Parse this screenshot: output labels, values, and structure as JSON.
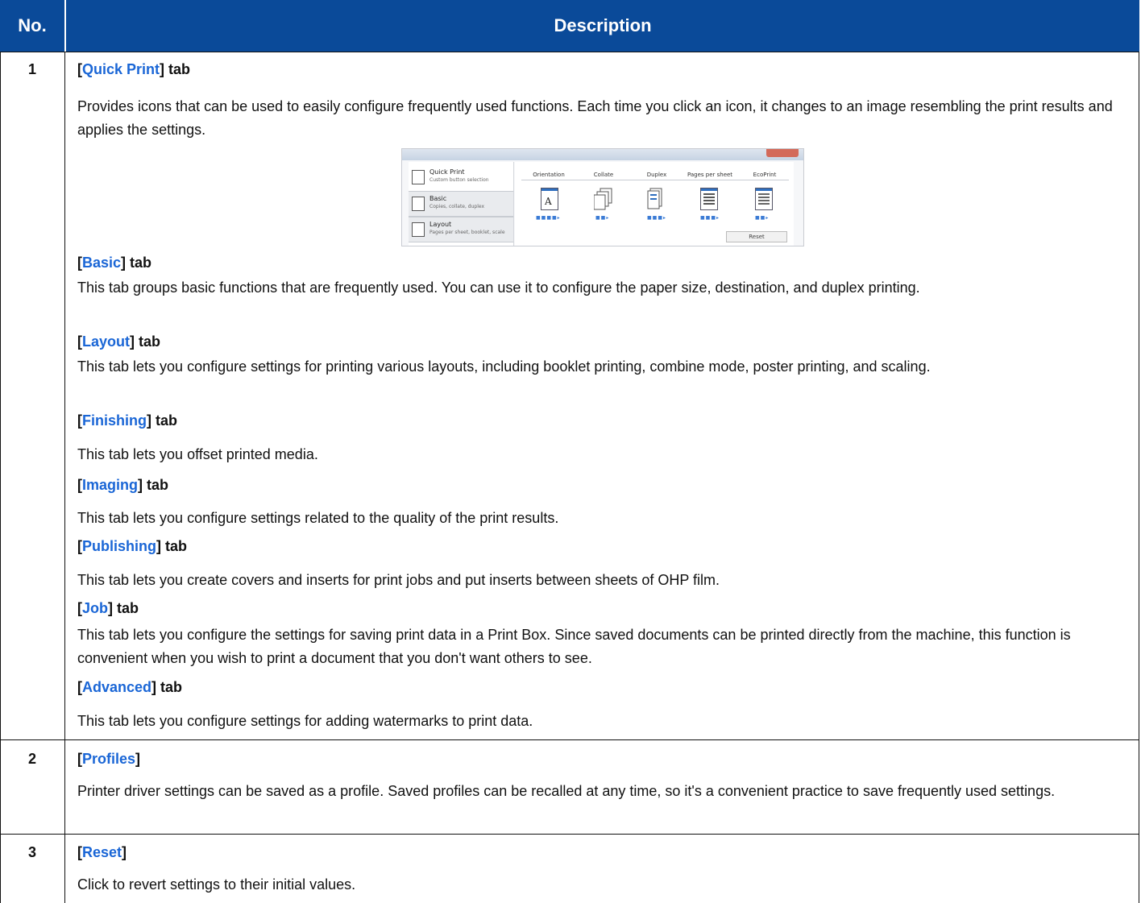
{
  "table": {
    "col_no": "No.",
    "col_desc": "Description"
  },
  "rows": [
    {
      "no": "1",
      "sections": [
        {
          "prefix": "[",
          "name": "Quick Print",
          "suffix": "] tab",
          "text": "Provides icons that can be used to easily configure frequently used functions. Each time you click an icon, it changes to an image resembling the print results and applies the settings."
        },
        {
          "prefix": "[",
          "name": "Basic",
          "suffix": "] tab",
          "text": "This tab groups basic functions that are frequently used. You can use it to configure the paper size, destination, and duplex printing."
        },
        {
          "prefix": "[",
          "name": "Layout",
          "suffix": "] tab",
          "text": "This tab lets you configure settings for printing various layouts, including booklet printing, combine mode, poster printing, and scaling."
        },
        {
          "prefix": "[",
          "name": "Finishing",
          "suffix": "] tab",
          "text": "This tab lets you offset printed media."
        },
        {
          "prefix": "[",
          "name": "Imaging",
          "suffix": "] tab",
          "text": "This tab lets you configure settings related to the quality of the print results."
        },
        {
          "prefix": "[",
          "name": "Publishing",
          "suffix": "] tab",
          "text": "This tab lets you create covers and inserts for print jobs and put inserts between sheets of OHP film."
        },
        {
          "prefix": "[",
          "name": "Job",
          "suffix": "] tab",
          "text": "This tab lets you configure the settings for saving print data in a Print Box. Since saved documents can be printed directly from the machine, this function is convenient when you wish to print a document that you don't want others to see."
        },
        {
          "prefix": "[",
          "name": "Advanced",
          "suffix": "] tab",
          "text": "This tab lets you configure settings for adding watermarks to print data."
        }
      ]
    },
    {
      "no": "2",
      "sections": [
        {
          "prefix": "[",
          "name": "Profiles",
          "suffix": "]",
          "text": "Printer driver settings can be saved as a profile. Saved profiles can be recalled at any time, so it's a convenient practice to save frequently used settings."
        }
      ]
    },
    {
      "no": "3",
      "sections": [
        {
          "prefix": "[",
          "name": "Reset",
          "suffix": "]",
          "text": "Click to revert settings to their initial values."
        }
      ]
    }
  ],
  "thumbnail": {
    "sidebar": [
      {
        "label": "Quick Print",
        "sub": "Custom button selection"
      },
      {
        "label": "Basic",
        "sub": "Copies, collate, duplex"
      },
      {
        "label": "Layout",
        "sub": "Pages per sheet, booklet, scale"
      }
    ],
    "columns": [
      "Orientation",
      "Collate",
      "Duplex",
      "Pages per sheet",
      "EcoPrint"
    ],
    "reset_label": "Reset"
  },
  "colors": {
    "header_bg": "#0a4a99",
    "link": "#1a66d6"
  }
}
